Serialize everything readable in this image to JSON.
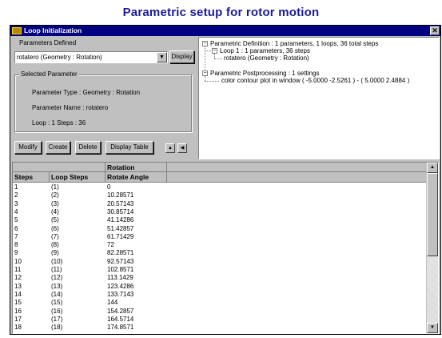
{
  "page_title": "Parametric setup for  rotor motion",
  "window": {
    "title": "Loop Initialization",
    "close_label": "✕"
  },
  "left": {
    "parameters_defined_label": "Parameters Defined",
    "combo_value": "rotatero (Geometry : Rotation)",
    "display_button": "Display",
    "selected_group_label": "Selected Parameter",
    "param_type": "Parameter Type : Geometry : Rotation",
    "param_name": "Parameter Name : rotatero",
    "loop_steps": "Loop : 1   Steps : 36",
    "buttons": {
      "modify": "Modify",
      "create": "Create",
      "delete": "Delete",
      "display_table": "Display Table"
    }
  },
  "tree": {
    "nodes": [
      "Parametric Definition : 1 parameters, 1 loops, 36 total steps",
      "Loop 1 : 1 parameters, 36 steps",
      "rotatero (Geometry : Rotation)",
      "Parametric Postprocessing : 1 settings",
      "color contour plot in window ( -5.0000 -2.5261 ) - ( 5.0000 2.4884 )"
    ]
  },
  "table": {
    "group_header": "Rotation",
    "columns": [
      "Steps",
      "Loop Steps",
      "Rotate Angle"
    ],
    "rows": [
      [
        "1",
        "(1)",
        "0"
      ],
      [
        "2",
        "(2)",
        "10.28571"
      ],
      [
        "3",
        "(3)",
        "20.57143"
      ],
      [
        "4",
        "(4)",
        "30.85714"
      ],
      [
        "5",
        "(5)",
        "41.14286"
      ],
      [
        "6",
        "(6)",
        "51.42857"
      ],
      [
        "7",
        "(7)",
        "61.71429"
      ],
      [
        "8",
        "(8)",
        "72"
      ],
      [
        "9",
        "(9)",
        "82.28571"
      ],
      [
        "10",
        "(10)",
        "92.57143"
      ],
      [
        "11",
        "(11)",
        "102.8571"
      ],
      [
        "12",
        "(12)",
        "113.1429"
      ],
      [
        "13",
        "(13)",
        "123.4286"
      ],
      [
        "14",
        "(14)",
        "133.7143"
      ],
      [
        "15",
        "(15)",
        "144"
      ],
      [
        "16",
        "(16)",
        "154.2857"
      ],
      [
        "17",
        "(17)",
        "164.5714"
      ],
      [
        "18",
        "(18)",
        "174.8571"
      ]
    ]
  },
  "colors": {
    "title_blue": "#1a1a9c",
    "titlebar": "#000080",
    "face": "#c0c0c0"
  }
}
